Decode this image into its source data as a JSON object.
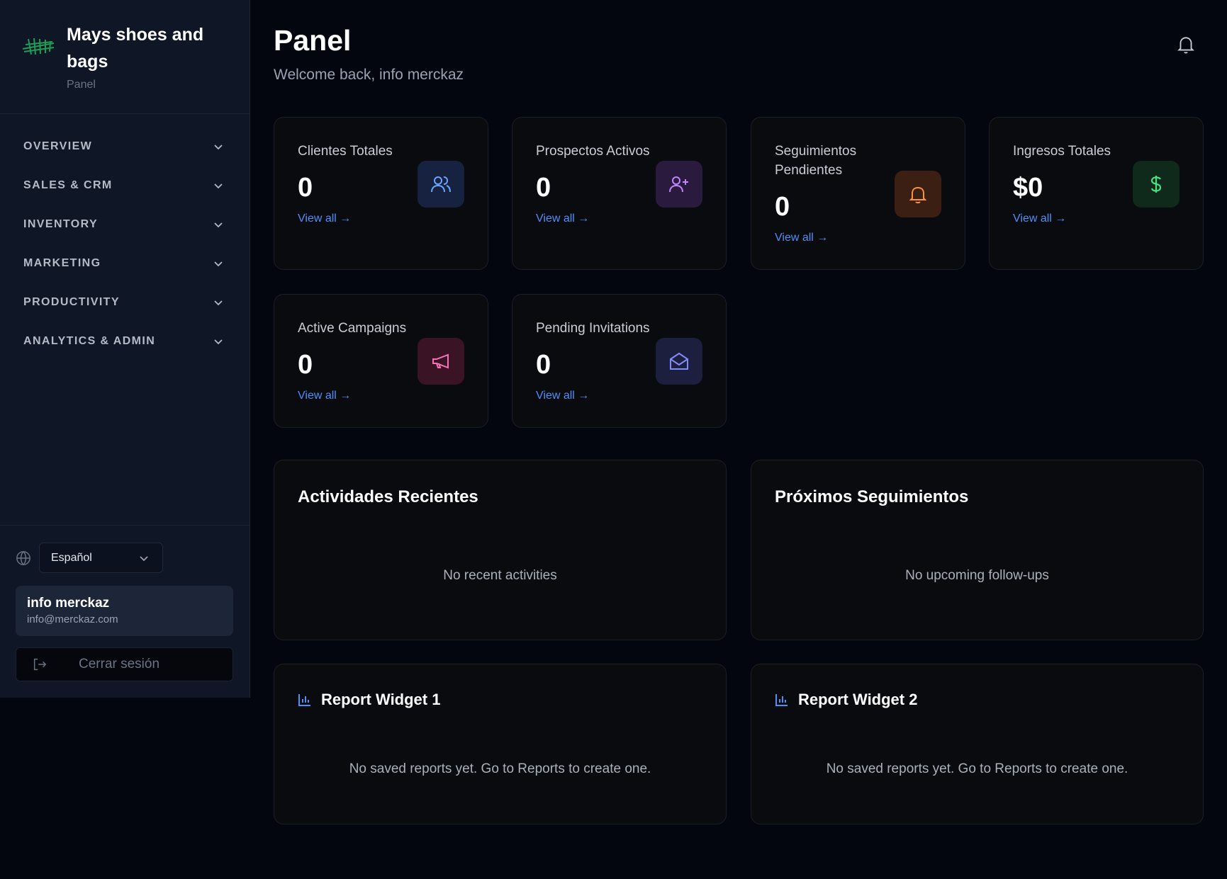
{
  "sidebar": {
    "brand_name": "Mays shoes and bags",
    "brand_sub": "Panel",
    "nav": [
      {
        "label": "OVERVIEW"
      },
      {
        "label": "SALES & CRM"
      },
      {
        "label": "INVENTORY"
      },
      {
        "label": "MARKETING"
      },
      {
        "label": "PRODUCTIVITY"
      },
      {
        "label": "ANALYTICS & ADMIN"
      }
    ],
    "language": "Español",
    "user": {
      "name": "info merckaz",
      "email": "info@merckaz.com"
    },
    "logout_label": "Cerrar sesión"
  },
  "header": {
    "title": "Panel",
    "subtitle": "Welcome back, info merckaz"
  },
  "stats": [
    {
      "title": "Clientes Totales",
      "value": "0",
      "link": "View all →",
      "icon": "users-icon",
      "color": "#6aa5ff",
      "bg": "#16223f"
    },
    {
      "title": "Prospectos Activos",
      "value": "0",
      "link": "View all →",
      "icon": "user-plus-icon",
      "color": "#c084fc",
      "bg": "#2a1a3e"
    },
    {
      "title": "Seguimientos Pendientes",
      "value": "0",
      "link": "View all →",
      "icon": "bell-icon",
      "color": "#fb923c",
      "bg": "#3a1f12"
    },
    {
      "title": "Ingresos Totales",
      "value": "$0",
      "link": "View all →",
      "icon": "dollar-icon",
      "color": "#4ade80",
      "bg": "#0f2a1a"
    },
    {
      "title": "Active Campaigns",
      "value": "0",
      "link": "View all →",
      "icon": "megaphone-icon",
      "color": "#f472b6",
      "bg": "#3a1424"
    },
    {
      "title": "Pending Invitations",
      "value": "0",
      "link": "View all →",
      "icon": "mail-open-icon",
      "color": "#818cf8",
      "bg": "#1c1f3e"
    }
  ],
  "panels": {
    "recent": {
      "title": "Actividades Recientes",
      "empty": "No recent activities"
    },
    "upcoming": {
      "title": "Próximos Seguimientos",
      "empty": "No upcoming follow-ups"
    },
    "report1": {
      "title": "Report Widget 1",
      "empty": "No saved reports yet. Go to Reports to create one."
    },
    "report2": {
      "title": "Report Widget 2",
      "empty": "No saved reports yet. Go to Reports to create one."
    }
  },
  "colors": {
    "accent": "#4f8ff7",
    "brand_green": "#1f9d55"
  }
}
